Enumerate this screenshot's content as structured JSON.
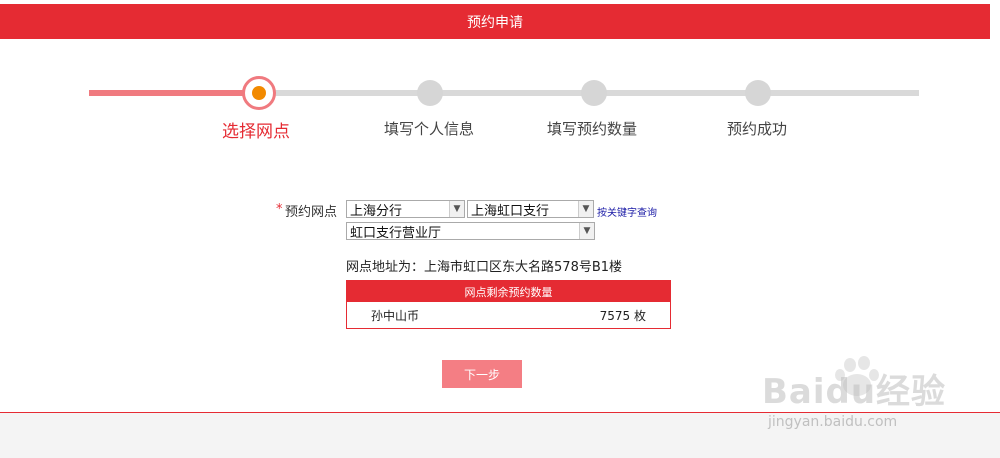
{
  "header": {
    "title": "预约申请"
  },
  "steps": [
    {
      "label": "选择网点",
      "active": true
    },
    {
      "label": "填写个人信息",
      "active": false
    },
    {
      "label": "填写预约数量",
      "active": false
    },
    {
      "label": "预约成功",
      "active": false
    }
  ],
  "form": {
    "required_mark": "*",
    "label": "预约网点",
    "branch": {
      "value": "上海分行"
    },
    "subbranch": {
      "value": "上海虹口支行"
    },
    "outlet": {
      "value": "虹口支行营业厅"
    },
    "search_link": "按关键字查询",
    "address_label": "网点地址为",
    "address_value": "上海市虹口区东大名路578号B1楼"
  },
  "table": {
    "header": "网点剩余预约数量",
    "rows": [
      {
        "name": "孙中山币",
        "qty": "7575 枚"
      }
    ]
  },
  "next_button": "下一步",
  "watermark": {
    "brand": "Baidu经验",
    "url": "jingyan.baidu.com"
  }
}
